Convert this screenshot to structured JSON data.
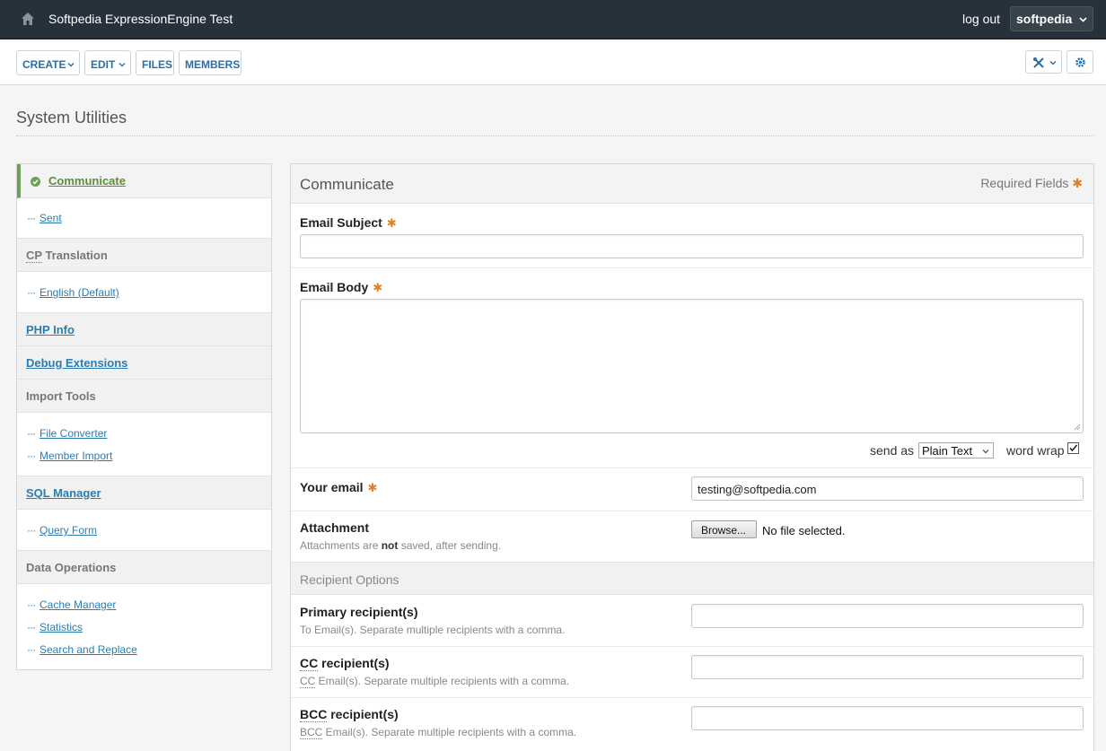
{
  "topbar": {
    "site_title": "Softpedia ExpressionEngine Test",
    "logout": "log out",
    "user": "softpedia"
  },
  "toolbar": {
    "create": "CREATE",
    "edit": "EDIT",
    "files": "FILES",
    "members": "MEMBERS"
  },
  "page_title": "System Utilities",
  "sidebar": {
    "active": "Communicate",
    "sent": "Sent",
    "cp_translation": {
      "abbr": "CP",
      "rest": " Translation"
    },
    "english": "English (Default)",
    "php_info": "PHP Info",
    "debug_extensions": "Debug Extensions",
    "import_tools": "Import Tools",
    "file_converter": "File Converter",
    "member_import": "Member Import",
    "sql_manager": "SQL Manager",
    "query_form": "Query Form",
    "data_operations": "Data Operations",
    "cache_manager": "Cache Manager",
    "statistics": "Statistics",
    "search_replace": "Search and Replace"
  },
  "form": {
    "title": "Communicate",
    "required_fields": "Required Fields",
    "required_marker": "✱",
    "email_subject_label": "Email Subject",
    "email_subject_value": "",
    "email_body_label": "Email Body",
    "send_as_label": "send as",
    "send_as_value": "Plain Text",
    "word_wrap_label": "word wrap",
    "word_wrap_checked": true,
    "your_email_label": "Your email",
    "your_email_value": "testing@softpedia.com",
    "attachment_label": "Attachment",
    "attachment_note_pre": "Attachments are ",
    "attachment_note_bold": "not",
    "attachment_note_post": " saved, after sending.",
    "browse_label": "Browse...",
    "no_file": "No file selected.",
    "recipient_options": "Recipient Options",
    "primary_label": "Primary recipient(s)",
    "primary_note": "To Email(s). Separate multiple recipients with a comma.",
    "cc_abbr": "CC",
    "cc_label_rest": " recipient(s)",
    "cc_note_rest": " Email(s). Separate multiple recipients with a comma.",
    "bcc_abbr": "BCC",
    "bcc_label_rest": " recipient(s)",
    "bcc_note_rest": " Email(s). Separate multiple recipients with a comma."
  },
  "colors": {
    "topbar": "#27313b",
    "link": "#2a7db3",
    "active": "#6ba15b",
    "required": "#e0812a"
  },
  "icons": [
    "home-icon",
    "chevron-down-icon",
    "tools-icon",
    "gear-icon",
    "check-circle-icon",
    "resize-handle-icon",
    "checkbox-checked-icon"
  ]
}
